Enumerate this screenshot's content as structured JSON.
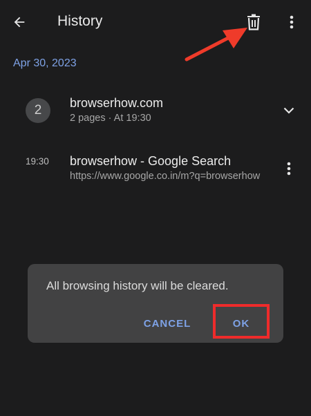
{
  "header": {
    "title": "History",
    "back_icon": "arrow-left-icon",
    "delete_icon": "trash-icon",
    "menu_icon": "more-vert-icon"
  },
  "section": {
    "date": "Apr 30, 2023"
  },
  "history": [
    {
      "badge": "2",
      "title": "browserhow.com",
      "subtitle": "2 pages · At 19:30",
      "action_icon": "chevron-down-icon"
    },
    {
      "time": "19:30",
      "title": "browserhow - Google Search",
      "subtitle": "https://www.google.co.in/m?q=browserhow",
      "action_icon": "more-vert-icon"
    }
  ],
  "dialog": {
    "message": "All browsing history will be cleared.",
    "cancel_label": "CANCEL",
    "ok_label": "OK"
  },
  "colors": {
    "background": "#1c1c1d",
    "accent": "#7ea2e6",
    "dialog": "#424243",
    "highlight": "#ee2b2b"
  }
}
